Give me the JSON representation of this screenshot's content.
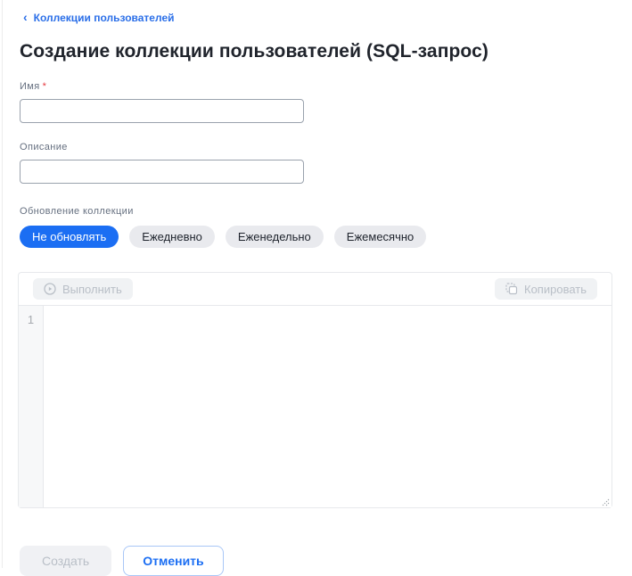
{
  "breadcrumb": {
    "chevron": "‹",
    "label": "Коллекции пользователей"
  },
  "page_title": "Создание коллекции пользователей (SQL-запрос)",
  "form": {
    "name_field": {
      "label": "Имя",
      "required_mark": "*",
      "value": "",
      "placeholder": ""
    },
    "description_field": {
      "label": "Описание",
      "value": "",
      "placeholder": ""
    },
    "refresh": {
      "label": "Обновление коллекции",
      "options": [
        {
          "label": "Не обновлять",
          "selected": true
        },
        {
          "label": "Ежедневно",
          "selected": false
        },
        {
          "label": "Еженедельно",
          "selected": false
        },
        {
          "label": "Ежемесячно",
          "selected": false
        }
      ]
    }
  },
  "sql_editor": {
    "run_button": {
      "label": "Выполнить",
      "icon": "play-circle-icon",
      "disabled": true
    },
    "copy_button": {
      "label": "Копировать",
      "icon": "copy-icon",
      "disabled": true
    },
    "line_numbers": [
      "1"
    ],
    "content": ""
  },
  "footer": {
    "create_button": {
      "label": "Создать",
      "disabled": true
    },
    "cancel_button": {
      "label": "Отменить",
      "disabled": false
    }
  },
  "colors": {
    "accent_blue": "#1b6ef3",
    "pill_gray_bg": "#e9eaee",
    "pill_text": "#1f242d",
    "disabled_bg": "#f0f1f4",
    "disabled_text": "#b9bfc7",
    "label_gray": "#667080",
    "title_dark": "#20242c",
    "panel_border": "#e7e9ec",
    "input_border": "#9aa2ad",
    "required_red": "#e5383f",
    "gutter_bg": "#f7f8f9",
    "cancel_border": "#a9c7f7"
  }
}
